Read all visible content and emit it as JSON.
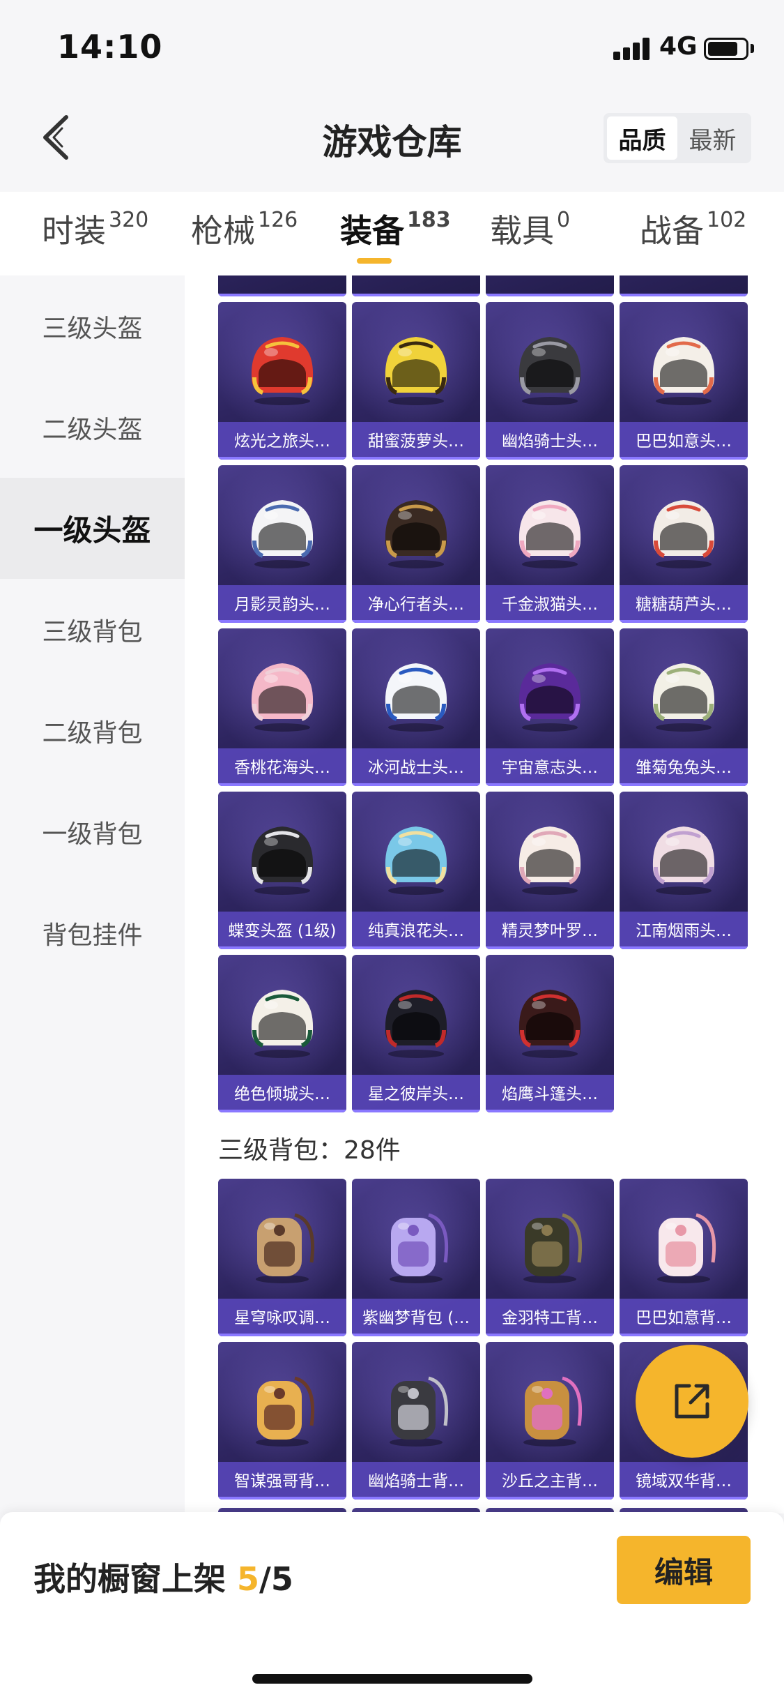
{
  "status_bar": {
    "time": "14:10",
    "network": "4G"
  },
  "header": {
    "title": "游戏仓库",
    "sort_options": [
      "品质",
      "最新"
    ],
    "sort_active": "品质"
  },
  "tabs": [
    {
      "label": "时装",
      "count": "320"
    },
    {
      "label": "枪械",
      "count": "126"
    },
    {
      "label": "装备",
      "count": "183"
    },
    {
      "label": "载具",
      "count": "0"
    },
    {
      "label": "战备",
      "count": "102"
    }
  ],
  "active_tab": "装备",
  "sidebar": {
    "items": [
      "三级头盔",
      "二级头盔",
      "一级头盔",
      "三级背包",
      "二级背包",
      "一级背包",
      "背包挂件"
    ],
    "active": "一级头盔"
  },
  "helmet_items": [
    "炫光之旅头…",
    "甜蜜菠萝头…",
    "幽焰骑士头…",
    "巴巴如意头…",
    "月影灵韵头…",
    "净心行者头…",
    "千金淑猫头…",
    "糖糖葫芦头…",
    "香桃花海头…",
    "冰河战士头…",
    "宇宙意志头…",
    "雏菊兔兔头…",
    "蝶变头盔 (1级)",
    "纯真浪花头…",
    "精灵梦叶罗…",
    "江南烟雨头…",
    "绝色倾城头…",
    "星之彼岸头…",
    "焰鹰斗篷头…"
  ],
  "section": {
    "title": "三级背包：28件"
  },
  "backpack_items": [
    "星穹咏叹调…",
    "紫幽梦背包 (…",
    "金羽特工背…",
    "巴巴如意背…",
    "智谋强哥背…",
    "幽焰骑士背…",
    "沙丘之主背…",
    "镜域双华背…"
  ],
  "bottom_bar": {
    "showcase_label": "我的橱窗上架",
    "showcase_current": "5",
    "showcase_total": "/5",
    "edit_label": "编辑"
  },
  "colors": {
    "accent": "#f5b52c",
    "card_bg": "#2e2560",
    "card_label_bg": "#5a48be"
  },
  "icons": [
    "back-chevron-icon",
    "signal-icon",
    "battery-icon",
    "share-external-icon"
  ]
}
